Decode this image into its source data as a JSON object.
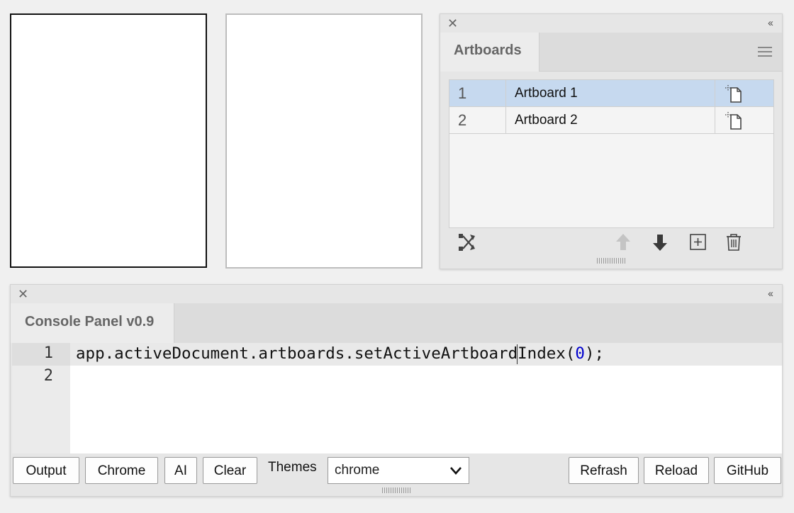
{
  "artboards_panel": {
    "tab_label": "Artboards",
    "rows": [
      {
        "index": "1",
        "name": "Artboard 1",
        "selected": true
      },
      {
        "index": "2",
        "name": "Artboard 2",
        "selected": false
      }
    ]
  },
  "console_panel": {
    "tab_label": "Console Panel v0.9",
    "line_numbers": [
      "1",
      "2"
    ],
    "code": {
      "before": "app.activeDocument.artboards.setActiveArtboardIndex(",
      "number": "0",
      "after": ");"
    },
    "buttons": {
      "output": "Output",
      "chrome": "Chrome",
      "ai": "AI",
      "clear": "Clear",
      "refresh": "Refrash",
      "reload": "Reload",
      "github": "GitHub"
    },
    "themes_label": "Themes",
    "themes_selected": "chrome"
  },
  "colors": {
    "selection": "#c6d9ef",
    "number_literal": "#0000cd"
  }
}
